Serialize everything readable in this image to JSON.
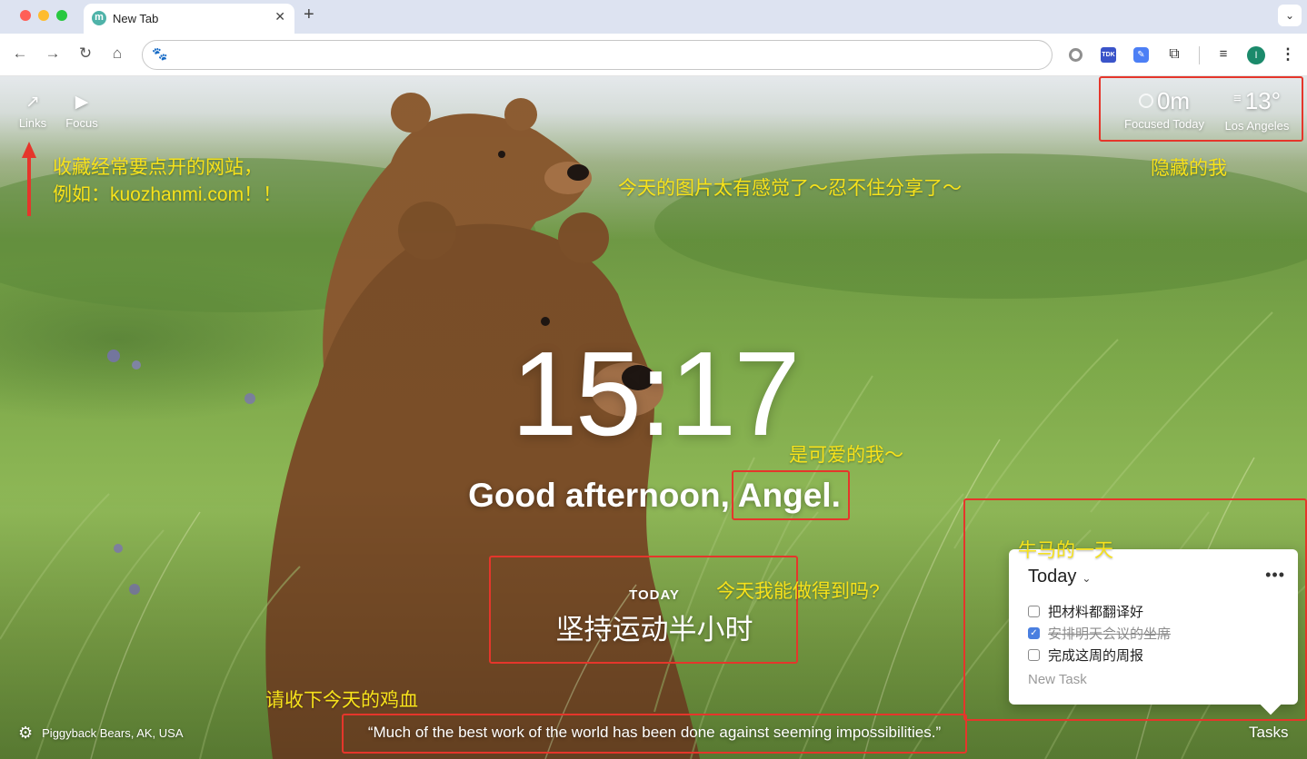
{
  "browser": {
    "tab_title": "New Tab",
    "tab_favicon": "m",
    "tab_close": "✕",
    "new_tab": "+",
    "tab_menu": "⌄",
    "profile_initial": "I",
    "icons": [
      "back-icon",
      "forward-icon",
      "reload-icon",
      "home-icon",
      "baidu-paw-icon",
      "extension-circle-icon",
      "tdk-extension-icon",
      "edit-extension-icon",
      "puzzle-icon",
      "media-queue-icon",
      "kebab-menu-icon"
    ],
    "ext_tdk_label": "TDK"
  },
  "widgets": {
    "links_label": "Links",
    "focus_label": "Focus",
    "focused_value": "0m",
    "focused_label": "Focused Today",
    "temperature": "13°",
    "location": "Los Angeles"
  },
  "main": {
    "clock": "15:17",
    "greeting": "Good afternoon, Angel.",
    "today_label": "TODAY",
    "focus_task": "坚持运动半小时"
  },
  "footer": {
    "photo_credit": "Piggyback Bears, AK, USA",
    "quote": "“Much of the best work of the world has been done against seeming impossibilities.”",
    "tasks_label": "Tasks"
  },
  "tasks_panel": {
    "title": "Today",
    "more": "•••",
    "items": [
      {
        "text": "把材料都翻译好",
        "done": false
      },
      {
        "text": "安排明天会议的坐席",
        "done": true
      },
      {
        "text": "完成这周的周报",
        "done": false
      }
    ],
    "new_task_placeholder": "New Task"
  },
  "annotations": {
    "links_note_1": "收藏经常要点开的网站，",
    "links_note_2": "例如：kuozhanmi.com！！",
    "image_note": "今天的图片太有感觉了～忍不住分享了～",
    "hidden_note": "隐藏的我",
    "name_note": "是可爱的我～",
    "focus_note": "今天我能做得到吗?",
    "tasks_note": "牛马的一天",
    "quote_note": "请收下今天的鸡血"
  },
  "colors": {
    "annotation_box": "#e5362b",
    "annotation_text": "#f7e21b",
    "checkbox_checked": "#4a7fe0"
  }
}
